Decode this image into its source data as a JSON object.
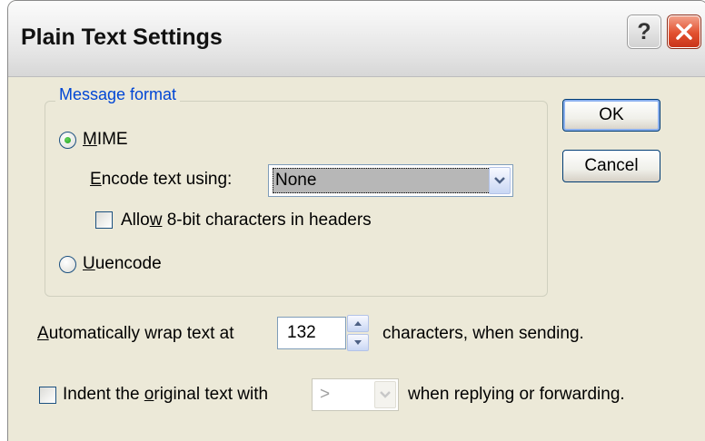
{
  "window": {
    "title": "Plain Text Settings",
    "help_glyph": "?",
    "help_icon": "help-icon",
    "close_icon": "close-icon"
  },
  "message_format": {
    "legend": "Message format",
    "mime": {
      "label": "MIME",
      "selected": true
    },
    "encode": {
      "label": "Encode text using:",
      "value": "None"
    },
    "allow_8bit": {
      "label": "Allow 8-bit characters in headers",
      "checked": false
    },
    "uuencode": {
      "label": "Uuencode",
      "selected": false
    }
  },
  "buttons": {
    "ok": "OK",
    "cancel": "Cancel"
  },
  "wrap": {
    "prefix": "Automatically wrap text at",
    "value": "132",
    "suffix": "characters, when sending."
  },
  "indent": {
    "label": "Indent the original text with",
    "value": ">",
    "suffix": "when replying or forwarding.",
    "checked": false,
    "enabled": false
  },
  "colors": {
    "accent": "#0046d5",
    "dialog_bg": "#ece9d8",
    "close_red": "#e2502f"
  }
}
